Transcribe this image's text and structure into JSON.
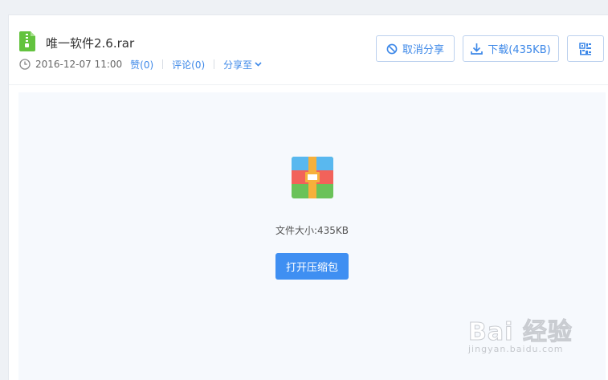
{
  "file": {
    "name": "唯一软件2.6.rar",
    "date": "2016-12-07 11:00",
    "like_label": "赞(0)",
    "comment_label": "评论(0)",
    "share_to_label": "分享至",
    "size_text": "文件大小:435KB"
  },
  "toolbar": {
    "unshare_label": "取消分享",
    "download_label": "下载(435KB)"
  },
  "preview": {
    "open_label": "打开压缩包"
  },
  "watermark": {
    "main": "Bai 经验",
    "sub": "jingyan.baidu.com"
  },
  "colors": {
    "accent": "#3d88e8",
    "button_primary": "#3f8ff2",
    "file_icon_green": "#63c33f",
    "background": "#eef1f5",
    "preview_bg": "#f6f9fd"
  },
  "icons": {
    "file_type": "zip-file-icon",
    "clock": "clock-icon",
    "unshare": "ban-icon",
    "download": "download-icon",
    "qr": "qr-code-icon",
    "archive": "archive-icon",
    "share_dropdown": "chevron-down-icon"
  }
}
